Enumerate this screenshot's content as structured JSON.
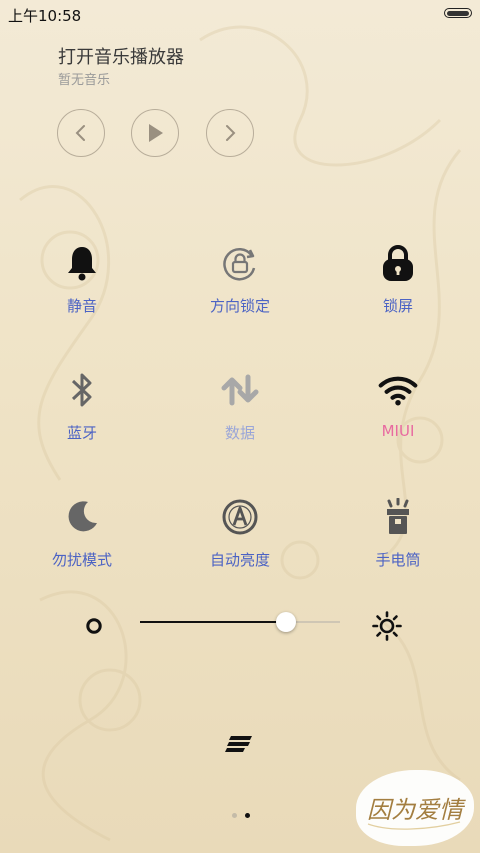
{
  "status_bar": {
    "time": "上午10:58"
  },
  "music": {
    "title": "打开音乐播放器",
    "subtitle": "暂无音乐",
    "controls": [
      "chevron-left-icon",
      "play-icon",
      "chevron-right-icon"
    ]
  },
  "toggles": [
    {
      "label": "静音",
      "icon": "bell-icon",
      "active": true
    },
    {
      "label": "方向锁定",
      "icon": "rotation-lock-icon",
      "active": false
    },
    {
      "label": "锁屏",
      "icon": "lock-icon",
      "active": true
    },
    {
      "label": "蓝牙",
      "icon": "bluetooth-icon",
      "active": false
    },
    {
      "label": "数据",
      "icon": "mobile-data-icon",
      "active": false
    },
    {
      "label": "MIUI",
      "icon": "wifi-icon",
      "active": true
    },
    {
      "label": "勿扰模式",
      "icon": "moon-icon",
      "active": false
    },
    {
      "label": "自动亮度",
      "icon": "auto-brightness-icon",
      "active": false
    },
    {
      "label": "手电筒",
      "icon": "flashlight-icon",
      "active": false
    }
  ],
  "brightness": {
    "level": 0.73,
    "min_icon": "brightness-low-icon",
    "max_icon": "brightness-high-icon"
  },
  "page_indicator": {
    "total": 2,
    "current": 2
  },
  "watermark": {
    "text": "因为爱情"
  },
  "colors": {
    "label": "#4c63c4",
    "label_disabled": "#9aa6d8",
    "label_wifi": "#e86aa0",
    "icon_active": "#111111",
    "icon_inactive": "#777777"
  }
}
